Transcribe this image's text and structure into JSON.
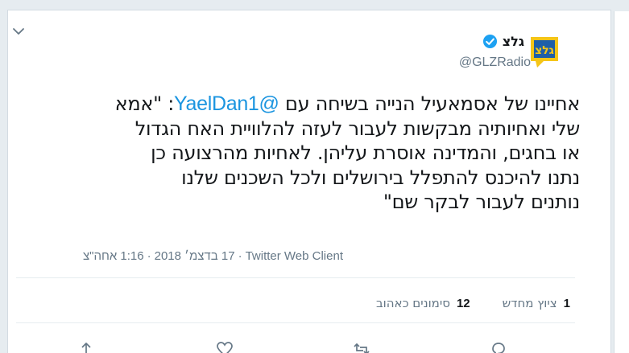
{
  "tweet": {
    "display_name": "גלצ",
    "handle": "@GLZRadio",
    "text_lines": [
      {
        "pre": "אחיינו של אסמאעיל הנייה בשיחה עם ",
        "mention": "@YaelDan1",
        "post": ": \"אמא"
      },
      {
        "text": "שלי ואחיותיה מבקשות לעבור לעזה להלוויית האח הגדול"
      },
      {
        "text": "או בחגים, והמדינה אוסרת עליהן. לאחיות מהרצועה כן"
      },
      {
        "text": "נתנו להיכנס להתפלל בירושלים ולכל השכנים שלנו"
      },
      {
        "text": "נותנים לעבור לבקר שם\""
      }
    ],
    "time": "1:16 אחה\"צ",
    "date": "17 בדצמ׳ 2018",
    "separator": "·",
    "client": "Twitter Web Client",
    "retweets_count": "1",
    "retweets_label": "ציוץ מחדש",
    "likes_count": "12",
    "likes_label": "סימונים כאהוב"
  },
  "icons": {
    "chevron": "chevron-down-icon",
    "verified": "verified-badge-icon",
    "avatar": "glz-logo",
    "reply": "reply-icon",
    "retweet": "retweet-icon",
    "like": "heart-icon",
    "share": "share-icon"
  },
  "colors": {
    "link": "#1b95e0",
    "verified": "#1da1f2",
    "logo_yellow": "#f5c518",
    "logo_blue": "#1f5fa8"
  }
}
